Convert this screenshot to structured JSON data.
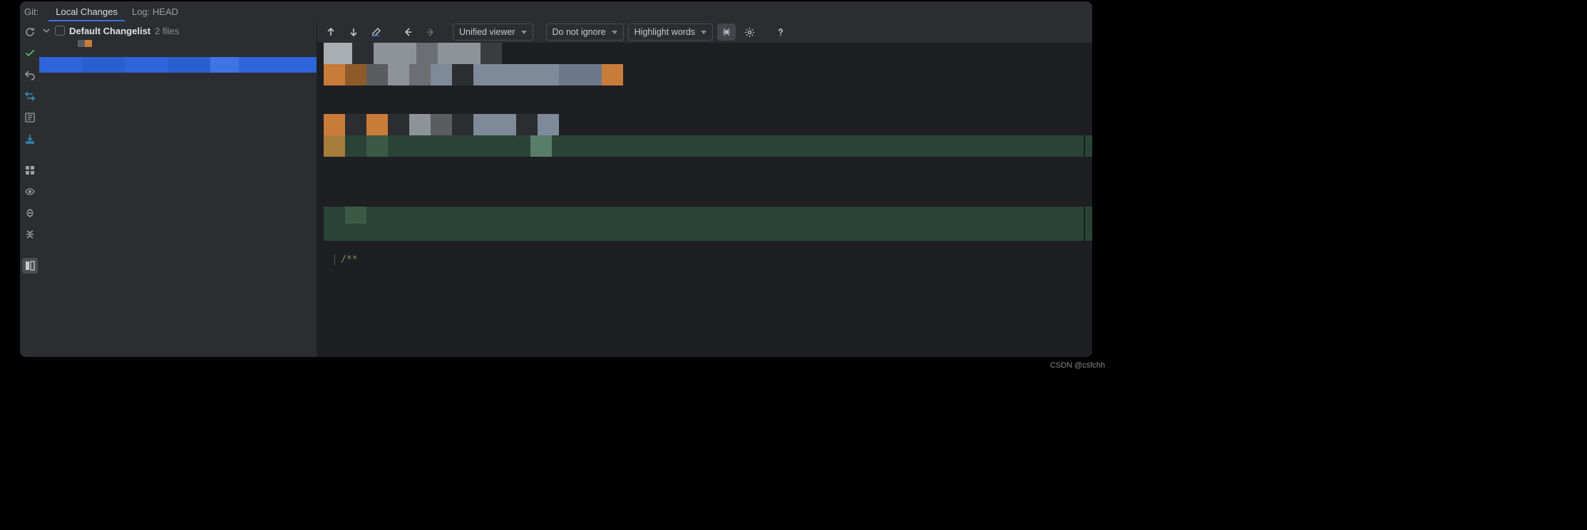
{
  "header": {
    "prefix": "Git:",
    "tabs": [
      {
        "label": "Local Changes",
        "active": true
      },
      {
        "label": "Log: HEAD",
        "active": false
      }
    ]
  },
  "rail": {
    "items": [
      {
        "name": "refresh-icon"
      },
      {
        "name": "commit-icon"
      },
      {
        "name": "rollback-icon"
      },
      {
        "name": "diff-icon"
      },
      {
        "name": "changelist-icon"
      },
      {
        "name": "shelve-icon"
      },
      {
        "name": "group-by-icon"
      },
      {
        "name": "show-icon"
      },
      {
        "name": "expand-all-icon"
      },
      {
        "name": "collapse-all-icon"
      },
      {
        "name": "preview-diff-icon"
      }
    ]
  },
  "changes": {
    "changelist_name": "Default Changelist",
    "file_count": "2 files"
  },
  "diff_toolbar": {
    "viewer_mode": "Unified viewer",
    "ignore_mode": "Do not ignore",
    "highlight_mode": "Highlight words"
  },
  "diff_body": {
    "code_fragment": "/**"
  },
  "watermark": "CSDN @csfchh"
}
